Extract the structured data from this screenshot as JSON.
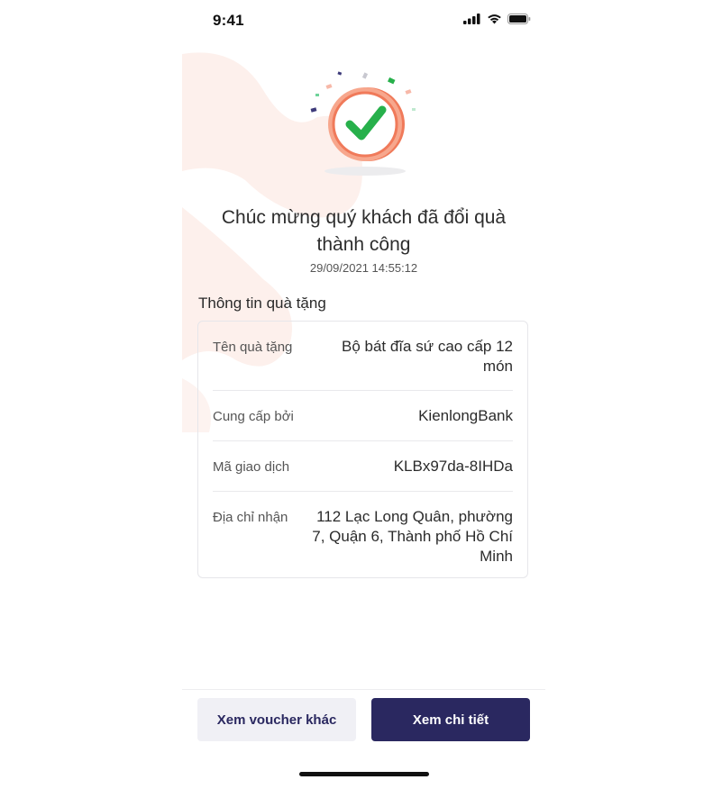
{
  "status_bar": {
    "time": "9:41"
  },
  "header": {
    "title": "Chúc mừng quý khách đã đổi quà thành công",
    "timestamp": "29/09/2021 14:55:12"
  },
  "gift_info": {
    "section_title": "Thông tin quà tặng",
    "rows": [
      {
        "label": "Tên quà tặng",
        "value": "Bộ bát đĩa sứ cao cấp 12 món"
      },
      {
        "label": "Cung cấp bởi",
        "value": "KienlongBank"
      },
      {
        "label": "Mã giao dịch",
        "value": "KLBx97da-8IHDa"
      },
      {
        "label": "Địa chỉ nhận",
        "value": "112 Lạc Long Quân, phường 7, Quận 6, Thành phố Hồ Chí Minh"
      }
    ]
  },
  "actions": {
    "secondary_label": "Xem voucher khác",
    "primary_label": "Xem chi tiết"
  },
  "colors": {
    "primary": "#2a2860",
    "secondary_bg": "#f0f0f5",
    "success_green": "#27b04b",
    "coin_orange": "#f07a5a",
    "deco_pink": "#fdeeea"
  }
}
